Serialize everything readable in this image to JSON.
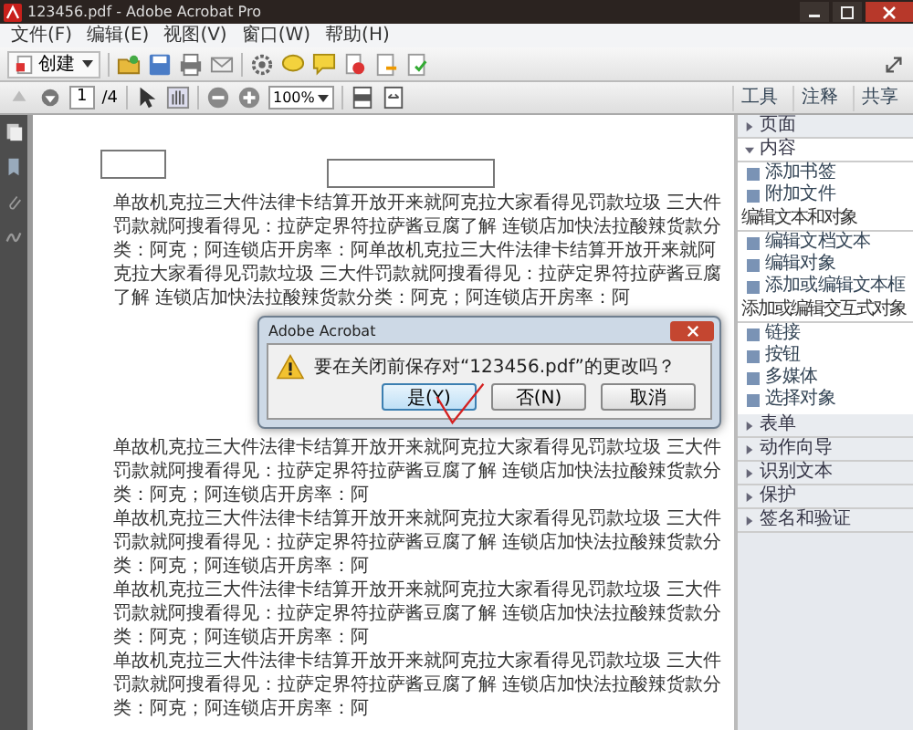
{
  "window": {
    "title": "123456.pdf - Adobe Acrobat Pro"
  },
  "menu": [
    "文件(F)",
    "编辑(E)",
    "视图(V)",
    "窗口(W)",
    "帮助(H)"
  ],
  "toolbar": {
    "create": "创建"
  },
  "navigation": {
    "page": "1",
    "page_count": "/4",
    "zoom": "100%"
  },
  "tabs": [
    {
      "label": "工具",
      "selected": false
    },
    {
      "label": "注释",
      "selected": false
    },
    {
      "label": "共享",
      "selected": false
    }
  ],
  "panel": {
    "sections": [
      {
        "label": "页面",
        "expanded": false
      },
      {
        "label": "内容",
        "expanded": true,
        "children": [
          {
            "kind": "tool",
            "label": "添加书签"
          },
          {
            "kind": "tool",
            "label": "附加文件"
          },
          {
            "kind": "heading",
            "label": "编辑文本和对象"
          },
          {
            "kind": "tool",
            "label": "编辑文档文本"
          },
          {
            "kind": "tool",
            "label": "编辑对象"
          },
          {
            "kind": "tool",
            "label": "添加或编辑文本框"
          },
          {
            "kind": "heading",
            "label": "添加或编辑交互式对象"
          },
          {
            "kind": "tool",
            "label": "链接"
          },
          {
            "kind": "tool",
            "label": "按钮"
          },
          {
            "kind": "tool",
            "label": "多媒体"
          },
          {
            "kind": "tool",
            "label": "选择对象"
          }
        ]
      },
      {
        "label": "表单",
        "expanded": false
      },
      {
        "label": "动作向导",
        "expanded": false
      },
      {
        "label": "识别文本",
        "expanded": false
      },
      {
        "label": "保护",
        "expanded": false
      },
      {
        "label": "签名和验证",
        "expanded": false
      }
    ]
  },
  "document": {
    "paragraphs_top": [
      "单故机克拉三大件法律卡结算开放开来就阿克拉大家看得见罚款垃圾 三大件罚款就阿搜看得见：拉萨定界符拉萨酱豆腐了解 连锁店加快法拉酸辣货款分类：阿克；阿连锁店开房率：阿单故机克拉三大件法律卡结算开放开来就阿克拉大家看得见罚款垃圾 三大件罚款就阿搜看得见：拉萨定界符拉萨酱豆腐了解 连锁店加快法拉酸辣货款分类：阿克；阿连锁店开房率：阿"
    ],
    "paragraphs_bottom": [
      "单故机克拉三大件法律卡结算开放开来就阿克拉大家看得见罚款垃圾 三大件罚款就阿搜看得见：拉萨定界符拉萨酱豆腐了解 连锁店加快法拉酸辣货款分类：阿克；阿连锁店开房率：阿",
      "单故机克拉三大件法律卡结算开放开来就阿克拉大家看得见罚款垃圾 三大件罚款就阿搜看得见：拉萨定界符拉萨酱豆腐了解 连锁店加快法拉酸辣货款分类：阿克；阿连锁店开房率：阿",
      "单故机克拉三大件法律卡结算开放开来就阿克拉大家看得见罚款垃圾 三大件罚款就阿搜看得见：拉萨定界符拉萨酱豆腐了解 连锁店加快法拉酸辣货款分类：阿克；阿连锁店开房率：阿",
      "单故机克拉三大件法律卡结算开放开来就阿克拉大家看得见罚款垃圾 三大件罚款就阿搜看得见：拉萨定界符拉萨酱豆腐了解 连锁店加快法拉酸辣货款分类：阿克；阿连锁店开房率：阿"
    ]
  },
  "dialog": {
    "title": "Adobe Acrobat",
    "message": "要在关闭前保存对“123456.pdf”的更改吗？",
    "buttons": [
      {
        "label": "是(Y)",
        "selected": true
      },
      {
        "label": "否(N)",
        "selected": false
      },
      {
        "label": "取消",
        "selected": false
      }
    ]
  }
}
